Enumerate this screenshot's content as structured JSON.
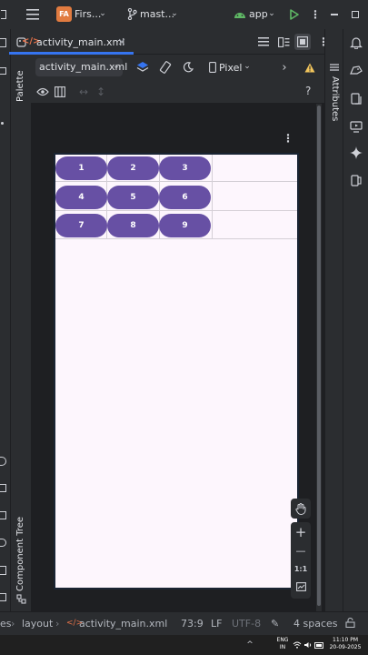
{
  "titlebar": {
    "menu_icon": "hamburger-menu-icon",
    "project_badge": "FA",
    "project_name": "Firs...",
    "branch_name": "mast...",
    "run_config": "app"
  },
  "tabs": [
    {
      "label": "activity_main.xml",
      "active": true
    }
  ],
  "toolbar1": {
    "file_select": "activity_main.xml",
    "device_select": "Pixel"
  },
  "side_panels": {
    "palette": "Palette",
    "component_tree": "Component Tree",
    "attributes": "Attributes"
  },
  "toolbar2": {
    "help": "?"
  },
  "grid_buttons": [
    {
      "label": "1"
    },
    {
      "label": "2"
    },
    {
      "label": "3"
    },
    {
      "label": "4"
    },
    {
      "label": "5"
    },
    {
      "label": "6"
    },
    {
      "label": "7"
    },
    {
      "label": "8"
    },
    {
      "label": "9"
    }
  ],
  "zoom": {
    "plus": "+",
    "minus": "—",
    "reset": "1:1"
  },
  "statusbar": {
    "breadcrumb_start": "es",
    "breadcrumb_1": "layout",
    "breadcrumb_2": "activity_main.xml",
    "position": "73:9",
    "line_sep": "LF",
    "encoding": "UTF-8",
    "indent": "4 spaces"
  },
  "taskbar": {
    "lang_1": "ENG",
    "lang_2": "IN",
    "time": "11:10 PM",
    "date": "20-09-2025"
  },
  "colors": {
    "accent": "#3574f0",
    "button": "#6750a4",
    "device_bg": "#fdf6fd",
    "warning": "#f2c55c",
    "run": "#5fb865"
  }
}
